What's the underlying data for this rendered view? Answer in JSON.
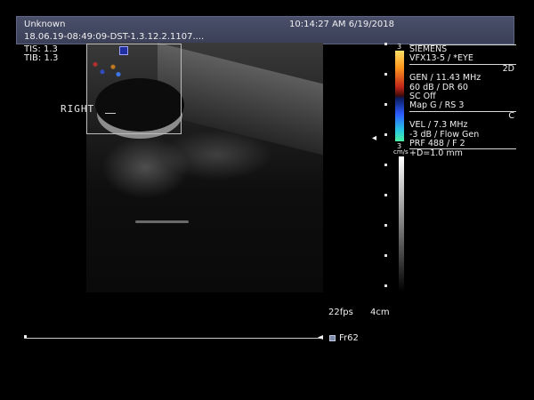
{
  "header": {
    "patient_name": "Unknown",
    "datetime": "10:14:27 AM 6/19/2018",
    "study_id": "18.06.19-08:49:09-DST-1.3.12.2.1107...."
  },
  "thermal": {
    "tis": "TIS: 1.3",
    "tib": "TIB: 1.3"
  },
  "image": {
    "side_label": "RIGHT"
  },
  "color_scale": {
    "top_value": "3",
    "bottom_value": "3",
    "unit": "cm/s",
    "colors": [
      "#ffe066",
      "#ff9a1f",
      "#c0261a",
      "#2d5cff",
      "#28c8e0",
      "#4af0a0"
    ]
  },
  "info_panel": {
    "manufacturer": "SIEMENS",
    "probe": "VFX13-5 / *EYE",
    "mode_2d": "2D",
    "gen": "GEN / 11.43 MHz",
    "db": "60 dB / DR 60",
    "sc": "SC Off",
    "map": "Map G / RS 3",
    "mode_c": "C",
    "vel": "VEL / 7.3 MHz",
    "flow": "-3 dB / Flow Gen",
    "prf": "PRF 488 / F 2",
    "distance": "+D=1.0 mm"
  },
  "status": {
    "fps": "22fps",
    "depth": "4cm"
  },
  "cine": {
    "frame": "Fr62"
  },
  "icons": {
    "depth_marker": "focus-marker-icon",
    "play": "cine-play-icon"
  }
}
